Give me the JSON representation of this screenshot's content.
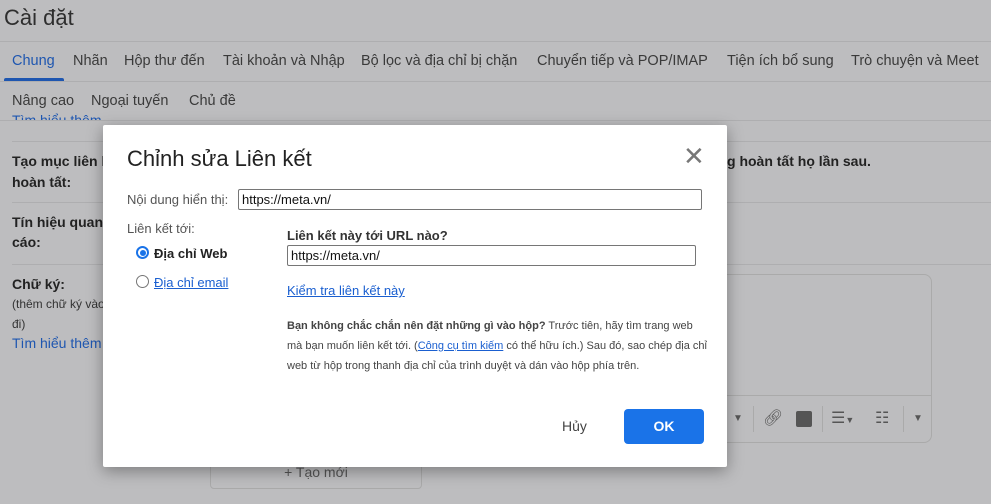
{
  "page": {
    "title": "Cài đặt",
    "learn_more_top": "Tìm hiểu thêm"
  },
  "tabs": [
    {
      "label": "Chung",
      "active": true
    },
    {
      "label": "Nhãn"
    },
    {
      "label": "Hộp thư đến"
    },
    {
      "label": "Tài khoản và Nhập"
    },
    {
      "label": "Bộ lọc và địa chỉ bị chặn"
    },
    {
      "label": "Chuyển tiếp và POP/IMAP"
    },
    {
      "label": "Tiện ích bổ sung"
    },
    {
      "label": "Trò chuyện và Meet"
    }
  ],
  "tabs2": [
    {
      "label": "Nâng cao"
    },
    {
      "label": "Ngoại tuyến"
    },
    {
      "label": "Chủ đề"
    }
  ],
  "settings": {
    "row1_line1": "Tạo mục liên h",
    "row1_line2": "hoàn tất:",
    "row1_right": "g hoàn tất họ lần sau.",
    "row2_line1": "Tín hiệu quan",
    "row2_line2": "cáo:",
    "sig_label": "Chữ ký:",
    "sig_desc1": "(thêm chữ ký vào",
    "sig_desc2": "đi)",
    "sig_learn_more": "Tìm hiểu thêm",
    "new_button": "+ Tạo mới"
  },
  "dialog": {
    "title": "Chỉnh sửa Liên kết",
    "display_label": "Nội dung hiển thị:",
    "display_value": "https://meta.vn/",
    "link_to_label": "Liên kết tới:",
    "options": [
      {
        "label": "Địa chỉ Web",
        "selected": true
      },
      {
        "label": "Địa chỉ email",
        "selected": false
      }
    ],
    "url_heading": "Liên kết này tới URL nào?",
    "url_value": "https://meta.vn/",
    "test_link": "Kiểm tra liên kết này",
    "help_bold": "Bạn không chắc chắn nên đặt những gì vào hộp?",
    "help_1": " Trước tiên, hãy tìm trang web mà bạn muốn liên kết tới. (",
    "help_link": "Công cụ tìm kiếm",
    "help_2": " có thể hữu ích.) Sau đó, sao chép địa chỉ web từ hộp trong thanh địa chỉ của trình duyệt và dán vào hộp phía trên.",
    "cancel": "Hủy",
    "ok": "OK"
  },
  "colors": {
    "accent": "#1a73e8",
    "scrim": "#bdbdbf"
  }
}
